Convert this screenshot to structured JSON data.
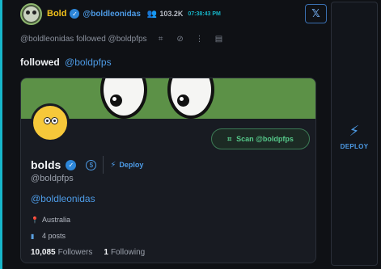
{
  "post": {
    "author_name": "Bold",
    "author_handle": "@boldleonidas",
    "follower_count": "103.2K",
    "timestamp": "07:38:43 PM",
    "subline": "@boldleonidas followed @boldpfps",
    "body_prefix": "followed",
    "body_link": "@boldpfps"
  },
  "actions": {
    "x_icon": "x-logo",
    "deploy_label": "DEPLOY"
  },
  "card": {
    "scan_label": "Scan @boldpfps",
    "name": "bolds",
    "deploy_label": "Deploy",
    "handle": "@boldpfps",
    "link": "@boldleonidas",
    "location": "Australia",
    "posts": "4 posts",
    "followers_count": "10,085",
    "followers_label": "Followers",
    "following_count": "1",
    "following_label": "Following"
  },
  "colors": {
    "accent": "#17b6c9",
    "name": "#f4c21b",
    "link": "#4d9be6",
    "banner": "#5c9147",
    "scan": "#56c98a"
  }
}
